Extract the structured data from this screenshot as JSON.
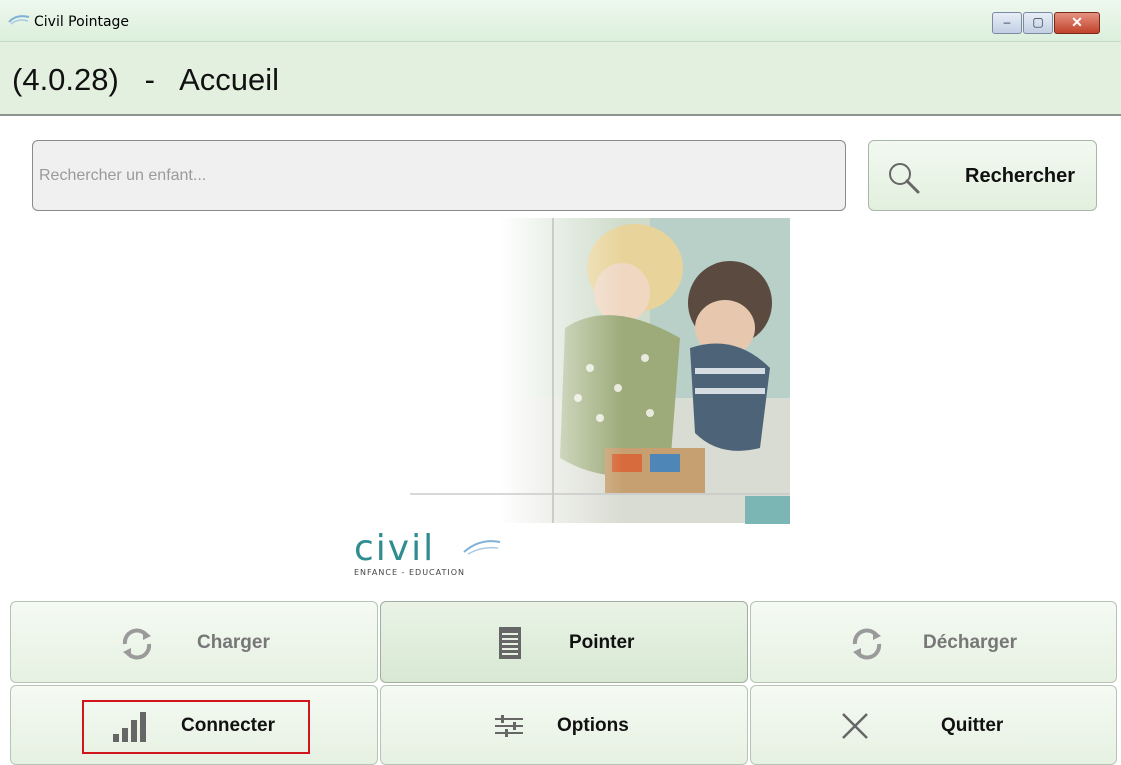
{
  "window": {
    "title": "Civil Pointage",
    "minimize_glyph": "–",
    "maximize_glyph": "▢",
    "close_glyph": "✕"
  },
  "header": {
    "title": "(4.0.28)   -   Accueil"
  },
  "search": {
    "placeholder": "Rechercher un enfant...",
    "value": "",
    "button_label": "Rechercher",
    "icon": "search-icon"
  },
  "logo": {
    "word": "civil",
    "tagline": "ENFANCE - EDUCATION"
  },
  "actions": {
    "charger": {
      "label": "Charger",
      "icon": "refresh-icon",
      "enabled": false
    },
    "pointer": {
      "label": "Pointer",
      "icon": "list-icon",
      "enabled": true
    },
    "decharger": {
      "label": "Décharger",
      "icon": "refresh-icon",
      "enabled": false
    },
    "connecter": {
      "label": "Connecter",
      "icon": "signal-bars-icon",
      "enabled": true
    },
    "options": {
      "label": "Options",
      "icon": "sliders-icon",
      "enabled": true
    },
    "quitter": {
      "label": "Quitter",
      "icon": "close-icon",
      "enabled": true
    }
  },
  "colors": {
    "accent_green": "#e3f0e0",
    "highlight_red": "#d0161c",
    "logo_teal": "#2f8d8f",
    "icon_gray": "#666666"
  }
}
